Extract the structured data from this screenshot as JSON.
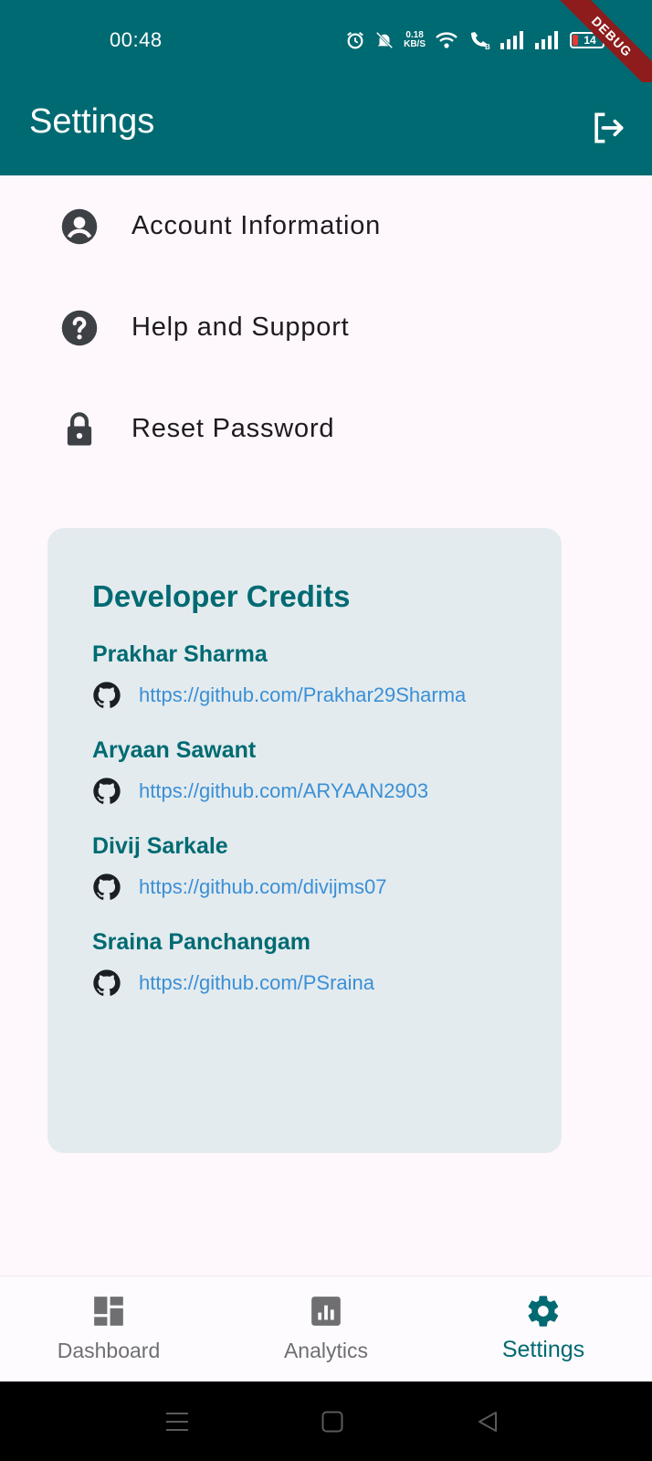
{
  "status_bar": {
    "time": "00:48",
    "net_speed_value": "0.18",
    "net_speed_unit": "KB/S",
    "battery_level": "14",
    "icons": [
      "alarm-icon",
      "mute-icon",
      "wifi-icon",
      "wifi-call-icon",
      "signal-icon",
      "signal-icon",
      "battery-icon"
    ]
  },
  "debug_banner": "DEBUG",
  "app_bar": {
    "title": "Settings",
    "action_icon": "logout-icon"
  },
  "menu": {
    "items": [
      {
        "label": "Account Information",
        "icon": "account-circle-icon"
      },
      {
        "label": "Help and Support",
        "icon": "help-icon"
      },
      {
        "label": "Reset Password",
        "icon": "lock-icon"
      }
    ]
  },
  "credits": {
    "title": "Developer Credits",
    "developers": [
      {
        "name": "Prakhar Sharma",
        "link": "https://github.com/Prakhar29Sharma"
      },
      {
        "name": "Aryaan Sawant",
        "link": "https://github.com/ARYAAN2903"
      },
      {
        "name": "Divij Sarkale",
        "link": "https://github.com/divijms07"
      },
      {
        "name": "Sraina Panchangam",
        "link": "https://github.com/PSraina"
      }
    ]
  },
  "bottom_nav": {
    "items": [
      {
        "label": "Dashboard",
        "icon": "dashboard-icon",
        "active": false
      },
      {
        "label": "Analytics",
        "icon": "analytics-icon",
        "active": false
      },
      {
        "label": "Settings",
        "icon": "settings-gear-icon",
        "active": true
      }
    ]
  },
  "colors": {
    "primary": "#006a72",
    "card_background": "#e3ebee",
    "link": "#3b8fd6",
    "page_background": "#fef7fb"
  }
}
